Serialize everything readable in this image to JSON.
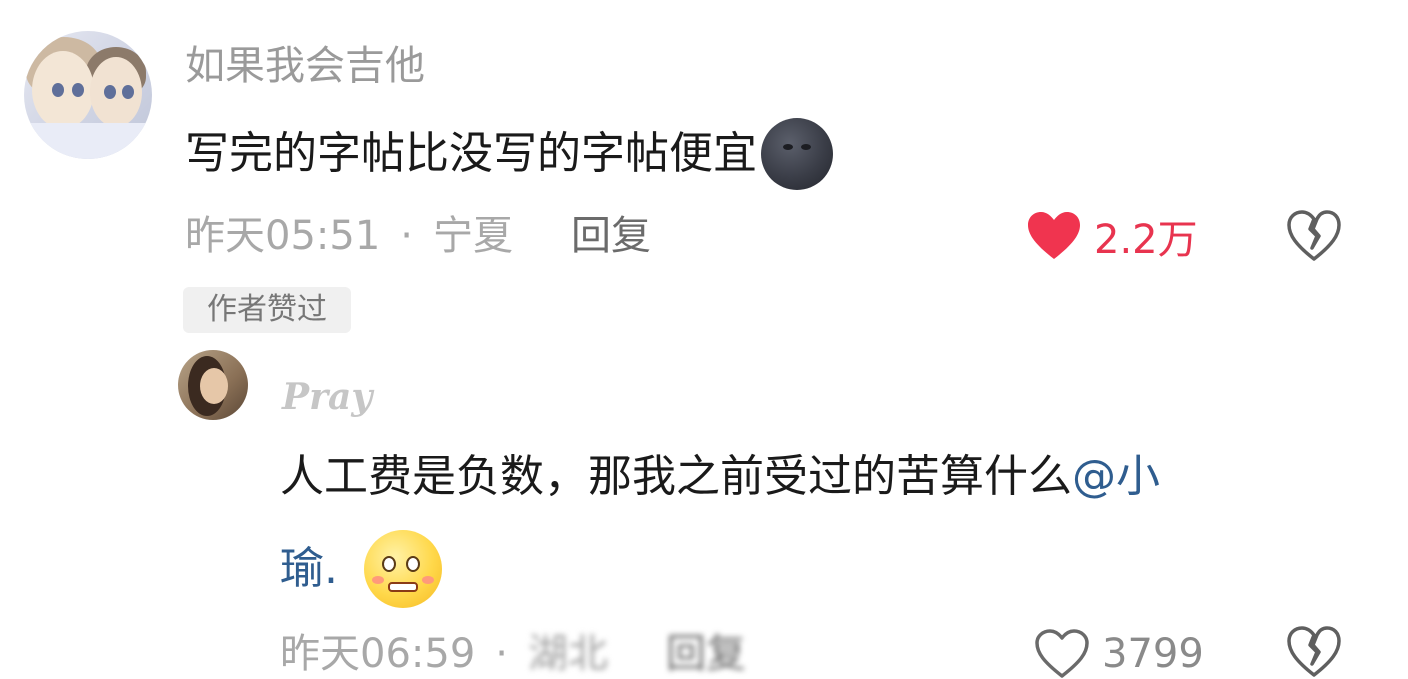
{
  "comment": {
    "username": "如果我会吉他",
    "text": "写完的字帖比没写的字帖便宜",
    "emoji": "new-moon-face",
    "time": "昨天05:51",
    "separator": "·",
    "location": "宁夏",
    "reply_label": "回复",
    "like_count": "2.2万",
    "liked": true,
    "like_color": "#e8344f",
    "author_tag": "作者赞过"
  },
  "reply": {
    "username": "Pray",
    "text_line1": "人工费是负数，那我之前受过的苦算什么",
    "mention_part1": "@小",
    "mention_part2": "瑜.",
    "emoji": "pleading-face",
    "time": "昨天06:59",
    "separator": "·",
    "location": "湖北",
    "reply_label": "回复",
    "like_count": "3799",
    "liked": false,
    "mention_color": "#2f5d8f"
  }
}
